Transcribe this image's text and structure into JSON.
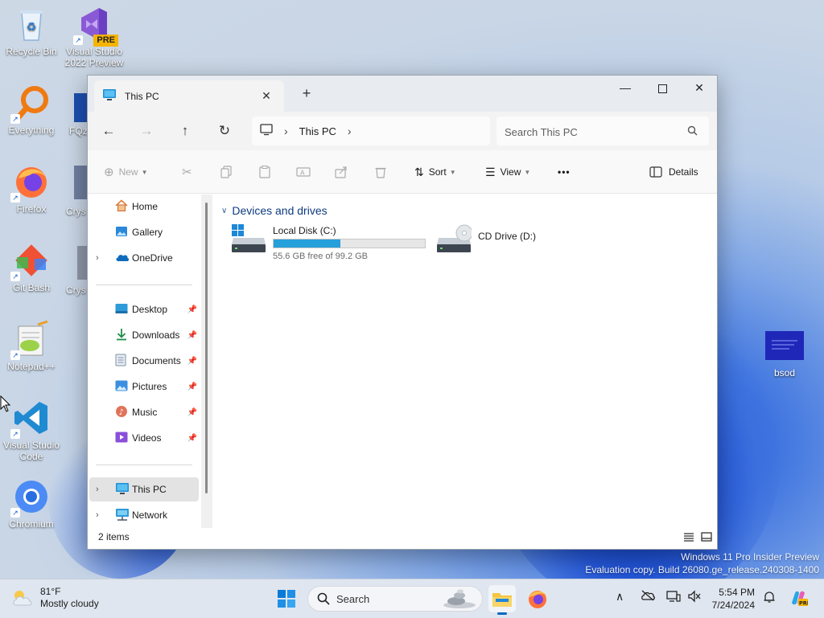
{
  "desktop": {
    "icons": [
      {
        "label": "Recycle Bin"
      },
      {
        "label": "Visual Studio 2022 Preview",
        "badge": "PRE"
      },
      {
        "label": "Everything"
      },
      {
        "label": "Firefox"
      },
      {
        "label": "Git Bash"
      },
      {
        "label": "Notepad++"
      },
      {
        "label": "Visual Studio Code"
      },
      {
        "label": "Chromium"
      },
      {
        "label": "bsod"
      }
    ],
    "partial_labels": [
      "FQz",
      "Crys",
      "Crys"
    ]
  },
  "window": {
    "tab_title": "This PC",
    "address": {
      "location": "This PC"
    },
    "search": {
      "placeholder": "Search This PC"
    },
    "commands": {
      "new": "New",
      "sort": "Sort",
      "view": "View",
      "more": "•••",
      "details": "Details"
    },
    "sidebar": {
      "home": "Home",
      "gallery": "Gallery",
      "onedrive": "OneDrive",
      "desktop": "Desktop",
      "downloads": "Downloads",
      "documents": "Documents",
      "pictures": "Pictures",
      "music": "Music",
      "videos": "Videos",
      "thispc": "This PC",
      "network": "Network"
    },
    "content": {
      "group": "Devices and drives",
      "drives": [
        {
          "name": "Local Disk (C:)",
          "free": "55.6 GB free of 99.2 GB",
          "used_fraction": 0.44
        },
        {
          "name": "CD Drive (D:)"
        }
      ]
    },
    "status": {
      "count": "2 items"
    }
  },
  "watermark": {
    "line1": "Windows 11 Pro Insider Preview",
    "line2": "Evaluation copy. Build 26080.ge_release.240308-1400"
  },
  "taskbar": {
    "weather": {
      "temp": "81°F",
      "condition": "Mostly cloudy"
    },
    "search_label": "Search",
    "clock": {
      "time": "5:54 PM",
      "date": "7/24/2024"
    }
  },
  "colors": {
    "accent": "#0067c0",
    "drive_bar": "#26a0da",
    "group_header": "#0e3b80"
  }
}
